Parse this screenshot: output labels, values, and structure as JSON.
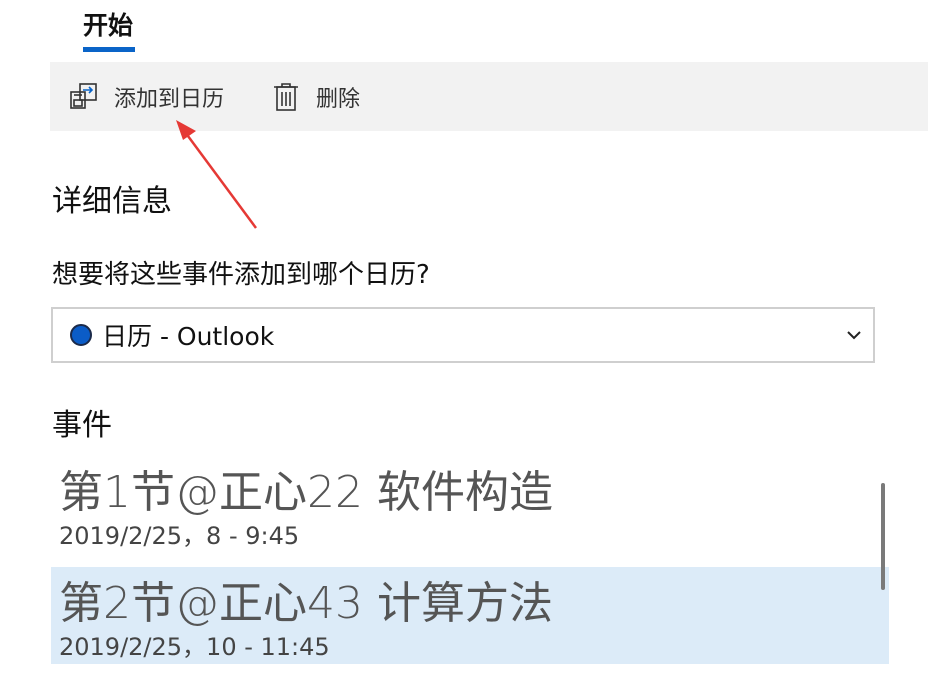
{
  "tab": {
    "label": "开始"
  },
  "toolbar": {
    "add_label": "添加到日历",
    "delete_label": "删除"
  },
  "details": {
    "heading": "详细信息",
    "question": "想要将这些事件添加到哪个日历?",
    "calendar_select": {
      "value": "日历 - Outlook",
      "color": "#0b5cc7"
    }
  },
  "events": {
    "heading": "事件",
    "items": [
      {
        "title": "第1节@正心22 软件构造",
        "time": "2019/2/25，8 - 9:45",
        "selected": false
      },
      {
        "title": "第2节@正心43 计算方法",
        "time": "2019/2/25，10 - 11:45",
        "selected": true
      }
    ]
  },
  "icons": {
    "add": "add-to-calendar-icon",
    "delete": "trash-icon",
    "dropdown": "chevron-down-icon"
  },
  "colors": {
    "accent": "#0a64c8",
    "toolbar_bg": "#f2f2f2",
    "selected_bg": "#dcebf8",
    "annotation_arrow": "#e53935"
  }
}
